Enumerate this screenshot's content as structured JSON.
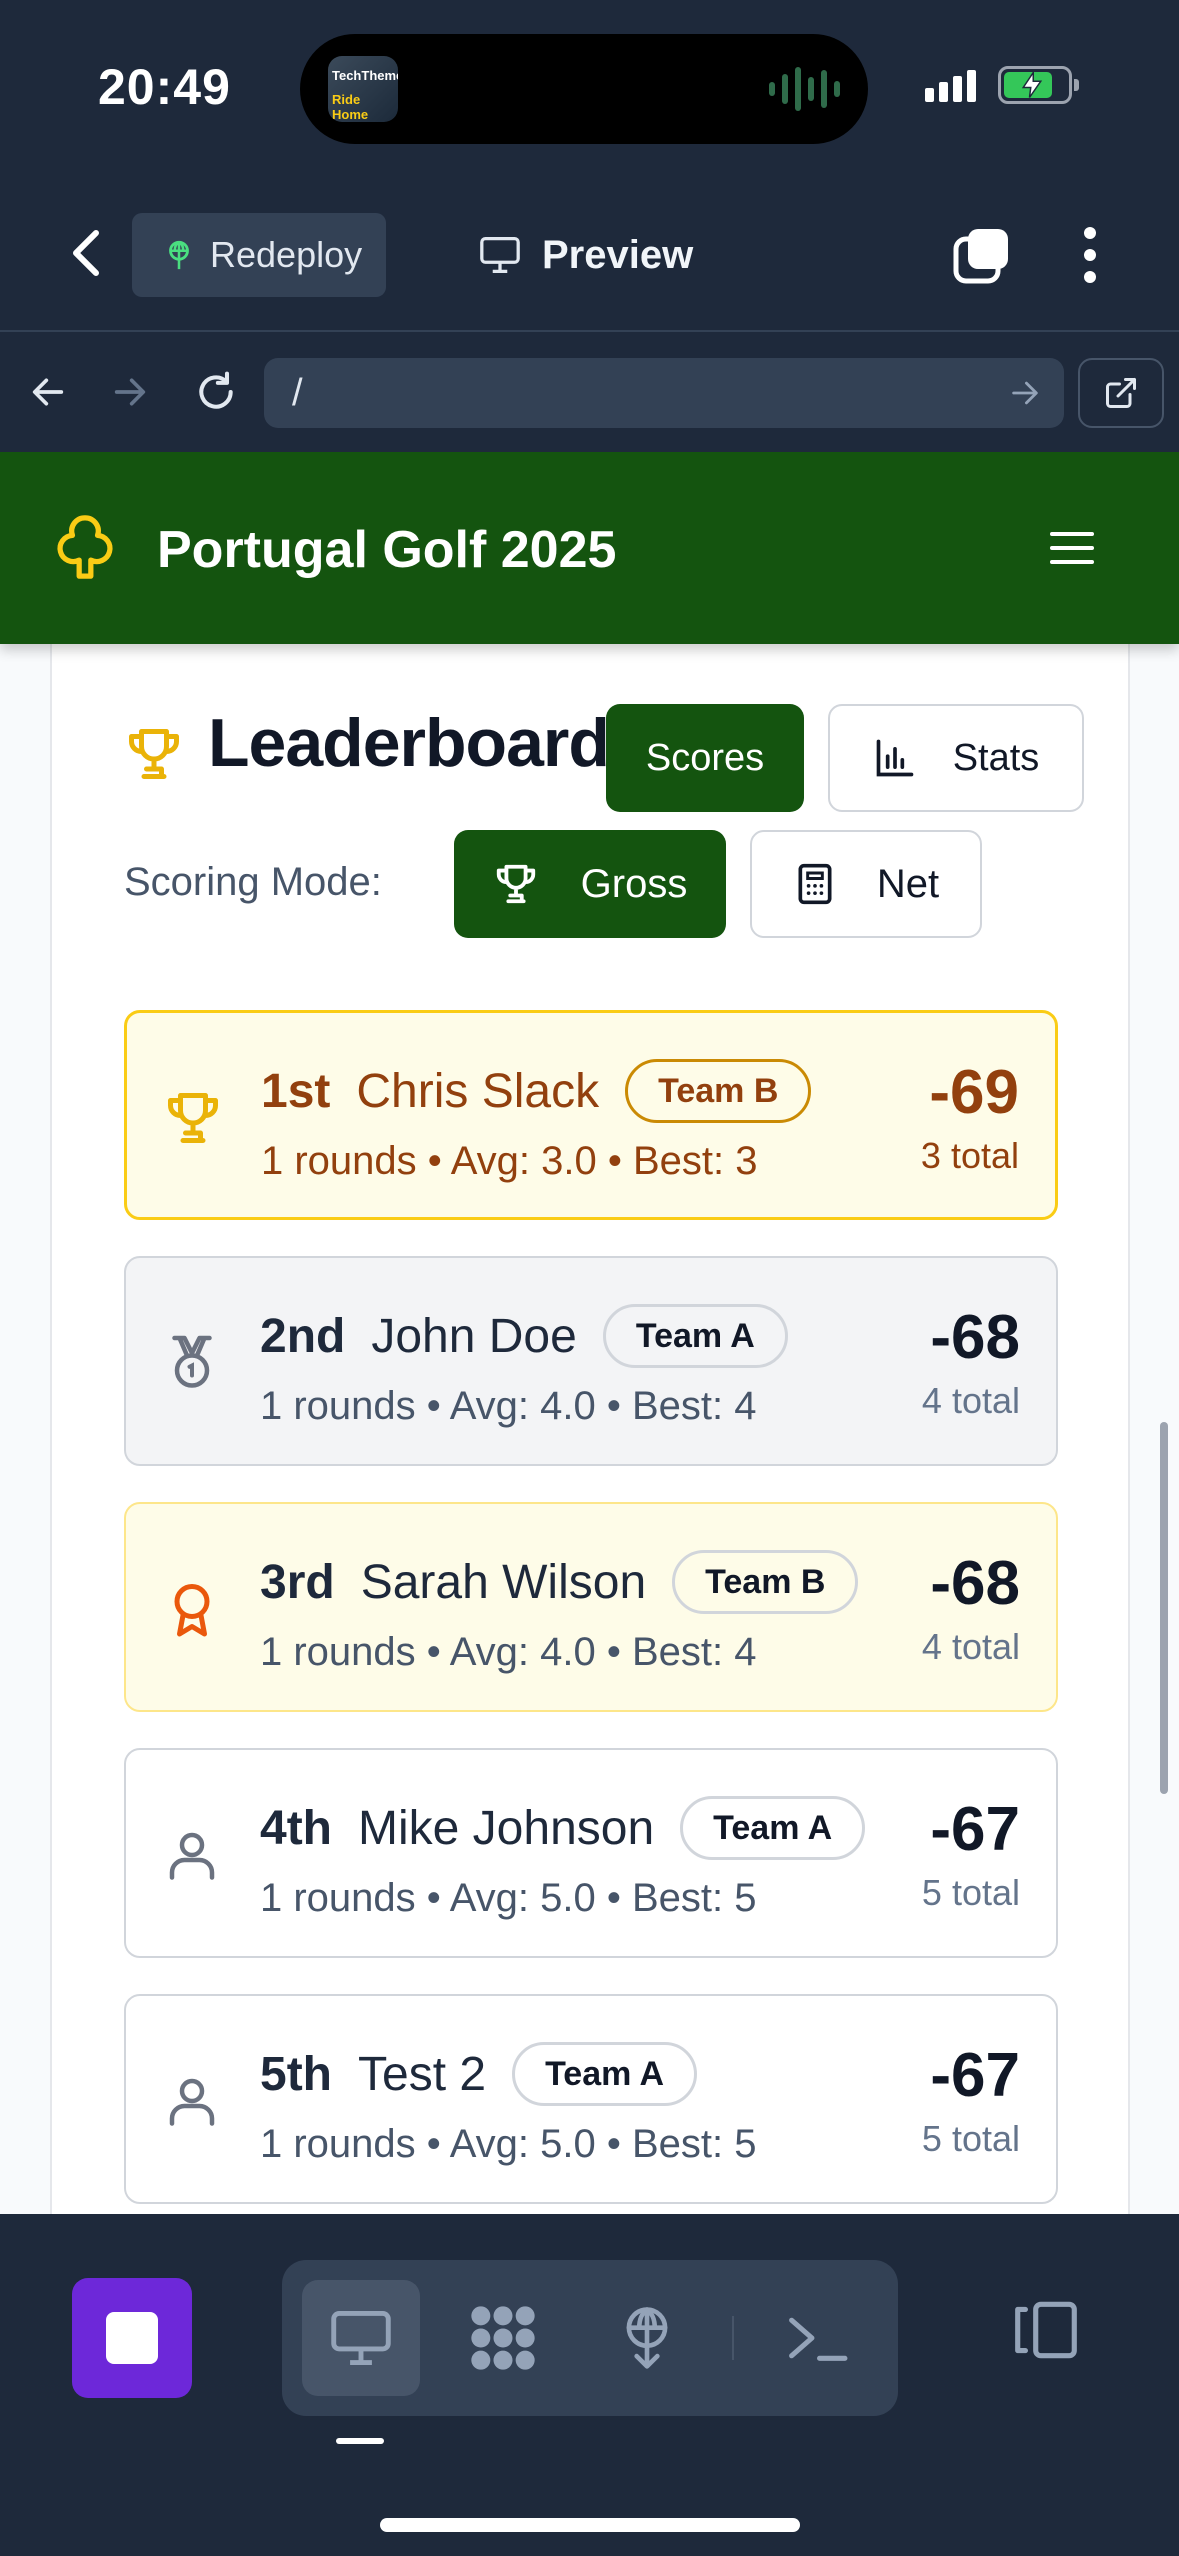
{
  "status_bar": {
    "time": "20:49",
    "island_app_line1": "TechTheme",
    "island_app_line2": "Ride Home"
  },
  "toolbar": {
    "redeploy_label": "Redeploy",
    "preview_label": "Preview"
  },
  "browser": {
    "url": "/"
  },
  "site": {
    "title": "Portugal Golf 2025"
  },
  "leaderboard": {
    "title": "Leaderboard",
    "scores_label": "Scores",
    "stats_label": "Stats",
    "scoring_mode_label": "Scoring Mode:",
    "gross_label": "Gross",
    "net_label": "Net",
    "rows": [
      {
        "rank": "1st",
        "name": "Chris Slack",
        "team": "Team B",
        "meta": "1 rounds • Avg: 3.0 • Best: 3",
        "score": "-69",
        "total": "3 total",
        "icon": "trophy-icon"
      },
      {
        "rank": "2nd",
        "name": "John Doe",
        "team": "Team A",
        "meta": "1 rounds • Avg: 4.0 • Best: 4",
        "score": "-68",
        "total": "4 total",
        "icon": "medal-icon"
      },
      {
        "rank": "3rd",
        "name": "Sarah Wilson",
        "team": "Team B",
        "meta": "1 rounds • Avg: 4.0 • Best: 4",
        "score": "-68",
        "total": "4 total",
        "icon": "award-icon"
      },
      {
        "rank": "4th",
        "name": "Mike Johnson",
        "team": "Team A",
        "meta": "1 rounds • Avg: 5.0 • Best: 5",
        "score": "-67",
        "total": "5 total",
        "icon": "user-icon"
      },
      {
        "rank": "5th",
        "name": "Test 2",
        "team": "Team A",
        "meta": "1 rounds • Avg: 5.0 • Best: 5",
        "score": "-67",
        "total": "5 total",
        "icon": "user-icon"
      }
    ]
  },
  "colors": {
    "header_green": "#14540f",
    "gold_row_bg": "#fefce8",
    "gold_row_border": "#facc15",
    "dock_stop": "#6d28d9"
  }
}
